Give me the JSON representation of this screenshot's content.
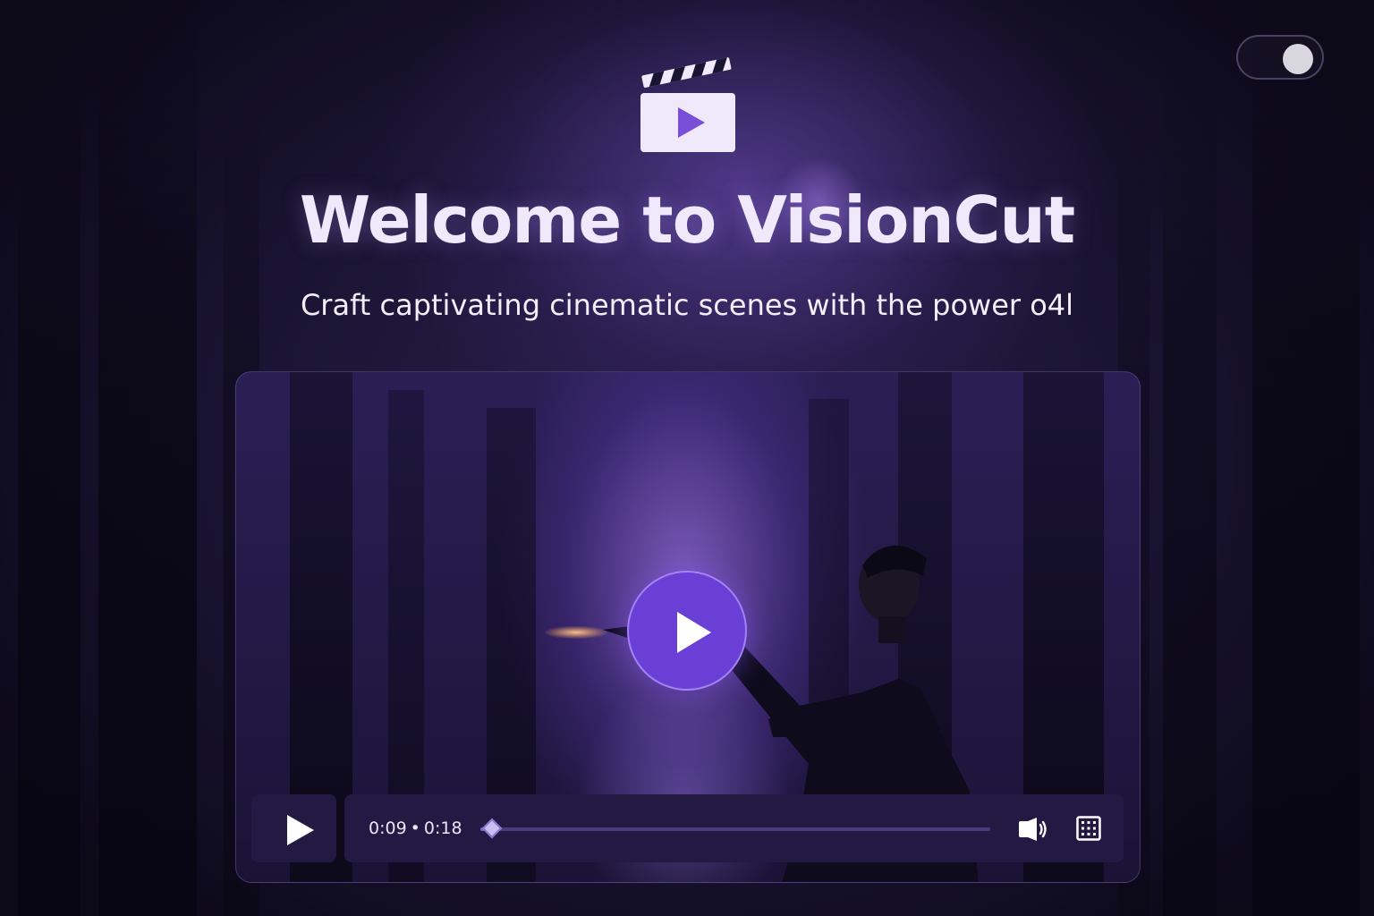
{
  "app": {
    "title": "Welcome to VisionCut",
    "subtitle": "Craft captivating cinematic scenes with the power o4l"
  },
  "colors": {
    "accent": "#6a3fd6",
    "background": "#1a1433",
    "control_bg": "#231a44",
    "text": "#efe9fb"
  },
  "icons": {
    "logo": "clapperboard-play-icon",
    "big_play": "play-icon",
    "control_play": "play-icon",
    "volume": "speaker-icon",
    "fullscreen": "grid-screen-icon"
  },
  "toggle": {
    "state": "on"
  },
  "player": {
    "current_time": "0:09",
    "separator": "•",
    "duration": "0:18",
    "progress": 0.02
  }
}
